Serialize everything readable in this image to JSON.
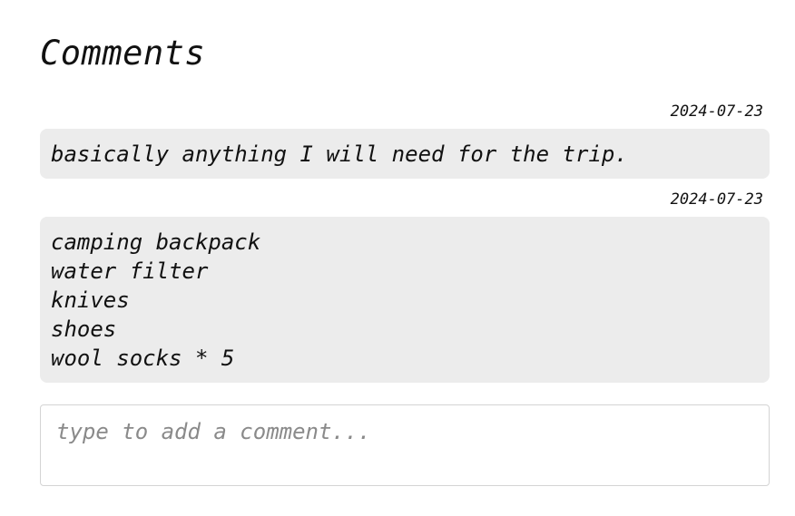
{
  "page": {
    "title": "Comments"
  },
  "comments": [
    {
      "date": "2024-07-23",
      "text": "basically anything I will need for the trip."
    },
    {
      "date": "2024-07-23",
      "text": "camping backpack\nwater filter\nknives\nshoes\nwool socks * 5"
    }
  ],
  "composer": {
    "value": "",
    "placeholder": "type to add a comment..."
  }
}
